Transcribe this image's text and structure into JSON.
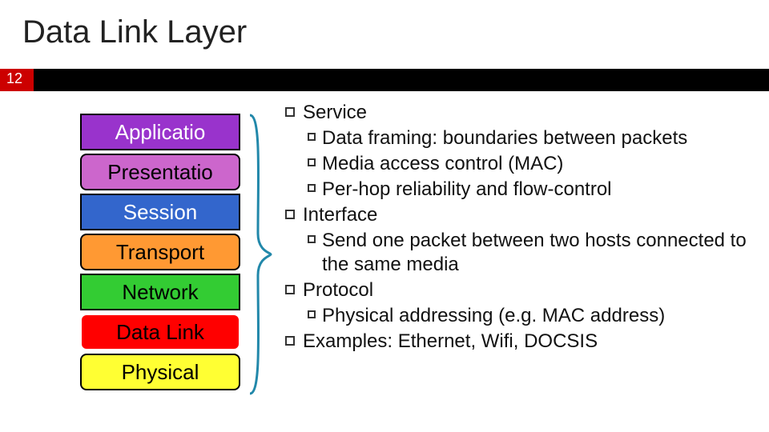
{
  "slide": {
    "title": "Data Link Layer",
    "number": "12"
  },
  "layers": {
    "application": "Applicatio",
    "presentation": "Presentatio",
    "session": "Session",
    "transport": "Transport",
    "network": "Network",
    "data_link": "Data Link",
    "physical": "Physical"
  },
  "body": {
    "service": {
      "heading": "Service",
      "b1": "Data framing: boundaries between packets",
      "b2": "Media access control (MAC)",
      "b3": "Per-hop reliability and flow-control"
    },
    "interface": {
      "heading": "Interface",
      "b1": "Send one packet between two hosts connected to the same media"
    },
    "protocol": {
      "heading": "Protocol",
      "b1": "Physical addressing (e.g. MAC address)"
    },
    "examples": {
      "heading": "Examples: Ethernet, Wifi, DOCSIS"
    }
  }
}
